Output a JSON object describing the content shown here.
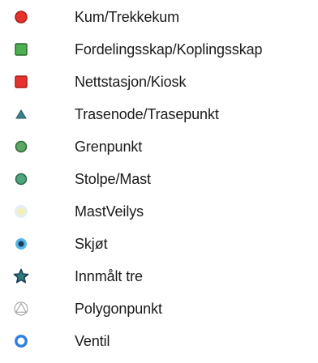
{
  "legend": {
    "items": [
      {
        "label": "Kum/Trekkekum",
        "icon": "red-circle-icon",
        "fill": "#e8312a",
        "stroke": "#a81b16"
      },
      {
        "label": "Fordelingsskap/Koplingsskap",
        "icon": "green-square-icon",
        "fill": "#4caf50",
        "stroke": "#2a6b2c"
      },
      {
        "label": "Nettstasjon/Kiosk",
        "icon": "red-square-icon",
        "fill": "#e8312a",
        "stroke": "#a81b16"
      },
      {
        "label": "Trasenode/Trasepunkt",
        "icon": "teal-triangle-icon",
        "fill": "#3d7d8c",
        "stroke": "#2b5c67"
      },
      {
        "label": "Grenpunkt",
        "icon": "green-circle-icon",
        "fill": "#5aa864",
        "stroke": "#2f6b36"
      },
      {
        "label": "Stolpe/Mast",
        "icon": "teal-green-circle-icon",
        "fill": "#4fa57e",
        "stroke": "#2e6a50"
      },
      {
        "label": "MastVeilys",
        "icon": "light-glow-icon",
        "fill": "#f5efb0",
        "stroke": "#e5eef8"
      },
      {
        "label": "Skjøt",
        "icon": "joint-circle-icon",
        "fill": "#1c3b57",
        "stroke": "#58b7e8"
      },
      {
        "label": "Innmålt tre",
        "icon": "star-icon",
        "fill": "#2f7d7a",
        "stroke": "#1b3f5a"
      },
      {
        "label": "Polygonpunkt",
        "icon": "polygon-point-icon",
        "fill": "#ffffff",
        "stroke": "#9a9a9a"
      },
      {
        "label": "Ventil",
        "icon": "valve-ring-icon",
        "fill": "#ffffff",
        "stroke": "#2f7fe0"
      }
    ]
  }
}
